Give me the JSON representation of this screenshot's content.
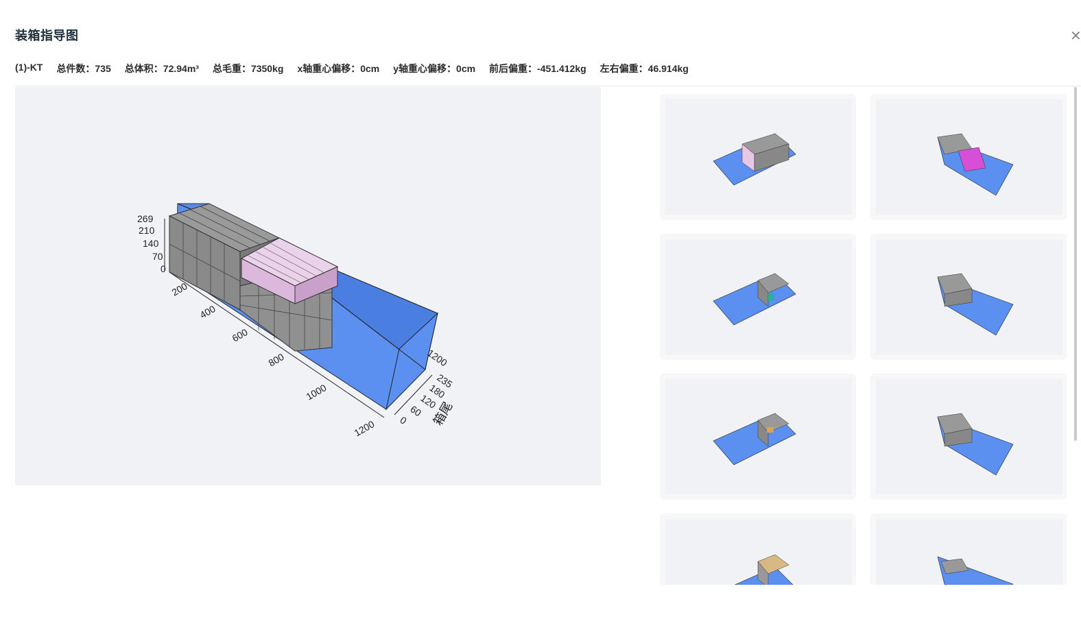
{
  "dialog": {
    "title": "装箱指导图",
    "close_icon": "close-icon"
  },
  "stats": [
    {
      "label": "(1)-KT"
    },
    {
      "label": "总件数：735"
    },
    {
      "label": "总体积：72.94m³"
    },
    {
      "label": "总毛重：7350kg"
    },
    {
      "label": "x轴重心偏移：0cm"
    },
    {
      "label": "y轴重心偏移：0cm"
    },
    {
      "label": "前后偏重：-451.412kg"
    },
    {
      "label": "左右偏重：46.914kg"
    }
  ],
  "main_view": {
    "z_ticks": [
      "269",
      "210",
      "140",
      "70",
      "0"
    ],
    "x_ticks": [
      "200",
      "400",
      "600",
      "800",
      "1000",
      "1200"
    ],
    "y_ticks": [
      "0",
      "60",
      "120",
      "180",
      "235"
    ],
    "far_tick": "1200",
    "axis_label": "箱尾"
  },
  "colors": {
    "container_blue": "#5b8ff0",
    "cargo_gray": "#8e8e8e",
    "cargo_pink": "#e6c7e6",
    "cargo_magenta": "#d64fd6",
    "cargo_teal": "#2ab0a0",
    "cargo_orange": "#e0a050",
    "cargo_tan": "#d8b884"
  },
  "thumbnails": [
    {
      "highlight": "pink"
    },
    {
      "highlight": "magenta"
    },
    {
      "highlight": "teal"
    },
    {
      "highlight": "none"
    },
    {
      "highlight": "orange"
    },
    {
      "highlight": "none"
    },
    {
      "highlight": "tan"
    },
    {
      "highlight": "none"
    }
  ]
}
